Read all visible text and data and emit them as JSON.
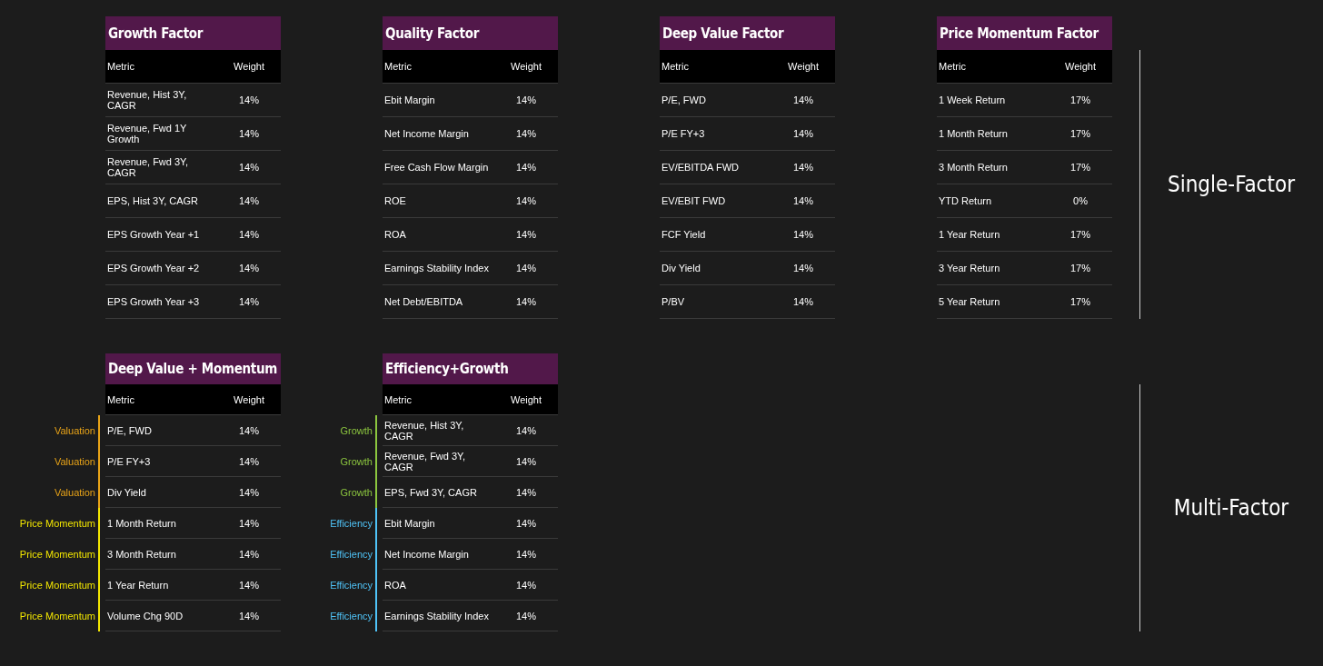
{
  "sections": [
    {
      "label": "Single-Factor",
      "tables": [
        {
          "title": "Growth Factor",
          "columns": [
            "Metric",
            "Weight"
          ],
          "rows": [
            {
              "metric": "Revenue, Hist 3Y, CAGR",
              "weight": "14%"
            },
            {
              "metric": "Revenue, Fwd 1Y Growth",
              "weight": "14%"
            },
            {
              "metric": "Revenue, Fwd 3Y, CAGR",
              "weight": "14%"
            },
            {
              "metric": "EPS, Hist 3Y, CAGR",
              "weight": "14%"
            },
            {
              "metric": "EPS Growth Year +1",
              "weight": "14%"
            },
            {
              "metric": "EPS Growth Year +2",
              "weight": "14%"
            },
            {
              "metric": "EPS Growth Year +3",
              "weight": "14%"
            }
          ]
        },
        {
          "title": "Quality Factor",
          "columns": [
            "Metric",
            "Weight"
          ],
          "rows": [
            {
              "metric": "Ebit Margin",
              "weight": "14%"
            },
            {
              "metric": "Net Income Margin",
              "weight": "14%"
            },
            {
              "metric": "Free Cash Flow Margin",
              "weight": "14%"
            },
            {
              "metric": "ROE",
              "weight": "14%"
            },
            {
              "metric": "ROA",
              "weight": "14%"
            },
            {
              "metric": "Earnings Stability Index",
              "weight": "14%"
            },
            {
              "metric": "Net Debt/EBITDA",
              "weight": "14%"
            }
          ]
        },
        {
          "title": "Deep Value Factor",
          "columns": [
            "Metric",
            "Weight"
          ],
          "rows": [
            {
              "metric": "P/E, FWD",
              "weight": "14%"
            },
            {
              "metric": "P/E FY+3",
              "weight": "14%"
            },
            {
              "metric": "EV/EBITDA FWD",
              "weight": "14%"
            },
            {
              "metric": "EV/EBIT FWD",
              "weight": "14%"
            },
            {
              "metric": "FCF Yield",
              "weight": "14%"
            },
            {
              "metric": "Div Yield",
              "weight": "14%"
            },
            {
              "metric": "P/BV",
              "weight": "14%"
            }
          ]
        },
        {
          "title": "Price Momentum Factor",
          "columns": [
            "Metric",
            "Weight"
          ],
          "rows": [
            {
              "metric": "1 Week Return",
              "weight": "17%"
            },
            {
              "metric": "1 Month Return",
              "weight": "17%"
            },
            {
              "metric": "3 Month Return",
              "weight": "17%"
            },
            {
              "metric": "YTD Return",
              "weight": "0%"
            },
            {
              "metric": "1 Year Return",
              "weight": "17%"
            },
            {
              "metric": "3 Year Return",
              "weight": "17%"
            },
            {
              "metric": "5 Year Return",
              "weight": "17%"
            }
          ]
        }
      ]
    },
    {
      "label": "Multi-Factor",
      "tables": [
        {
          "title": "Deep Value + Momentum",
          "columns": [
            "Metric",
            "Weight"
          ],
          "rows": [
            {
              "category": "Valuation",
              "color": "#e8a317",
              "metric": "P/E, FWD",
              "weight": "14%"
            },
            {
              "category": "Valuation",
              "color": "#e8a317",
              "metric": "P/E FY+3",
              "weight": "14%"
            },
            {
              "category": "Valuation",
              "color": "#e8a317",
              "metric": "Div Yield",
              "weight": "14%"
            },
            {
              "category": "Price Momentum",
              "color": "#f2e600",
              "metric": "1 Month Return",
              "weight": "14%"
            },
            {
              "category": "Price Momentum",
              "color": "#f2e600",
              "metric": "3 Month Return",
              "weight": "14%"
            },
            {
              "category": "Price Momentum",
              "color": "#f2e600",
              "metric": "1 Year Return",
              "weight": "14%"
            },
            {
              "category": "Price Momentum",
              "color": "#f2e600",
              "metric": "Volume Chg 90D",
              "weight": "14%"
            }
          ]
        },
        {
          "title": "Efficiency+Growth",
          "columns": [
            "Metric",
            "Weight"
          ],
          "rows": [
            {
              "category": "Growth",
              "color": "#8cc63f",
              "metric": "Revenue, Hist 3Y, CAGR",
              "weight": "14%"
            },
            {
              "category": "Growth",
              "color": "#8cc63f",
              "metric": "Revenue, Fwd 3Y, CAGR",
              "weight": "14%"
            },
            {
              "category": "Growth",
              "color": "#8cc63f",
              "metric": "EPS, Fwd 3Y, CAGR",
              "weight": "14%"
            },
            {
              "category": "Efficiency",
              "color": "#4fc3f7",
              "metric": "Ebit Margin",
              "weight": "14%"
            },
            {
              "category": "Efficiency",
              "color": "#4fc3f7",
              "metric": "Net Income Margin",
              "weight": "14%"
            },
            {
              "category": "Efficiency",
              "color": "#4fc3f7",
              "metric": "ROA",
              "weight": "14%"
            },
            {
              "category": "Efficiency",
              "color": "#4fc3f7",
              "metric": "Earnings Stability Index",
              "weight": "14%"
            }
          ]
        }
      ]
    }
  ]
}
